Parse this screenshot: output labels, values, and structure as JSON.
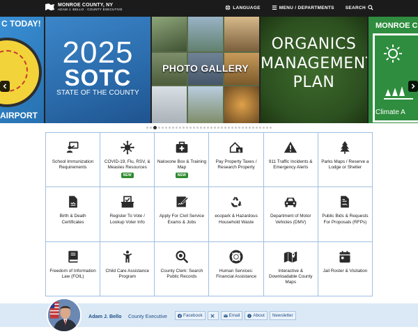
{
  "header": {
    "title": "MONROE COUNTY, NY",
    "subtitle": "ADAM J. BELLO · COUNTY EXECUTIVE",
    "nav": {
      "language": "LANGUAGE",
      "menu": "MENU / DEPARTMENTS",
      "search": "SEARCH"
    }
  },
  "carousel": {
    "slide_a_top": "C TODAY!",
    "slide_a_bottom": "AIRPORT",
    "sotc": {
      "year": "2025",
      "word": "SOTC",
      "sub": "STATE OF THE COUNTY"
    },
    "photo_gallery": "PHOTO GALLERY",
    "organics": [
      "ORGANICS",
      "MANAGEMENT",
      "PLAN"
    ],
    "climate_title": "MONROE C",
    "climate_foot": "Climate A",
    "dot_count": 36,
    "active_dot": 2
  },
  "services": [
    {
      "label": "School Immunization Requirements",
      "icon": "teacher-board-icon"
    },
    {
      "label": "COVID-19, Flu, RSV, & Measles Resources",
      "icon": "virus-icon",
      "badge": "NEW"
    },
    {
      "label": "Naloxone Box & Training Map",
      "icon": "first-aid-kit-icon",
      "badge": "NEW"
    },
    {
      "label": "Pay Property Taxes / Research Property",
      "icon": "house-dollar-icon"
    },
    {
      "label": "911 Traffic Incidents & Emergency Alerts",
      "icon": "warning-triangle-icon"
    },
    {
      "label": "Parks Maps / Reserve a Lodge or Shelter",
      "icon": "tree-icon"
    },
    {
      "label": "Birth & Death Certificates",
      "icon": "document-signature-icon"
    },
    {
      "label": "Register To Vote / Lookup Voter Info",
      "icon": "ballot-box-icon"
    },
    {
      "label": "Apply For Civil Service Exams & Jobs",
      "icon": "pencil-signature-icon"
    },
    {
      "label": "ecopark & Hazardous Household Waste",
      "icon": "recycle-icon"
    },
    {
      "label": "Department of Motor Vehicles (DMV)",
      "icon": "car-icon"
    },
    {
      "label": "Public Bids & Requests For Proposals (RFPs)",
      "icon": "file-contract-icon"
    },
    {
      "label": "Freedom of Information Law (FOIL)",
      "icon": "book-icon"
    },
    {
      "label": "Child Care Assistance Program",
      "icon": "child-icon"
    },
    {
      "label": "County Clerk: Search Public Records",
      "icon": "magnifier-icon"
    },
    {
      "label": "Human Services: Financial Assistance",
      "icon": "life-ring-icon"
    },
    {
      "label": "Interactive & Downloadable County Maps",
      "icon": "map-pin-icon"
    },
    {
      "label": "Jail Roster & Visitation",
      "icon": "calendar-icon"
    }
  ],
  "exec": {
    "name": "Adam J. Bello",
    "title": "County Executive",
    "links": {
      "facebook": "Facebook",
      "x": "",
      "email": "Email",
      "about": "About",
      "newsletter": "Newsletter"
    }
  },
  "colors": {
    "header_bg": "#1b1b1b",
    "grid_border": "#9fbfe0",
    "exec_bar": "#dbe9f6",
    "new_badge": "#2f8a2f",
    "link_blue": "#1f4e86"
  }
}
